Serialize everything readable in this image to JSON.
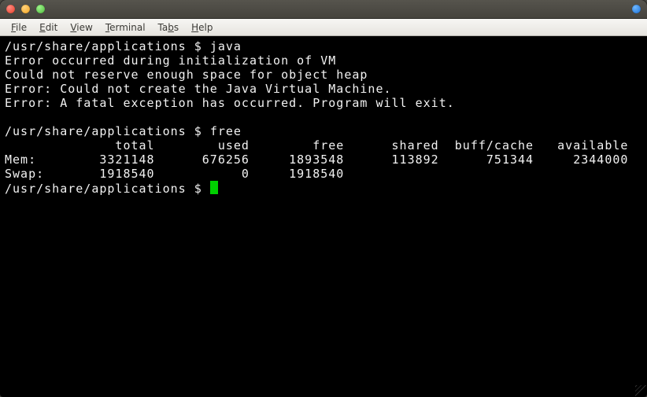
{
  "menubar": {
    "file": "File",
    "edit": "Edit",
    "view": "View",
    "terminal": "Terminal",
    "tabs": "Tabs",
    "help": "Help"
  },
  "prompt": {
    "cwd": "/usr/share/applications",
    "sep": " $ "
  },
  "commands": {
    "java": "java",
    "free": "free"
  },
  "java_output": {
    "l1": "Error occurred during initialization of VM",
    "l2": "Could not reserve enough space for object heap",
    "l3": "Error: Could not create the Java Virtual Machine.",
    "l4": "Error: A fatal exception has occurred. Program will exit."
  },
  "free_output": {
    "header": "              total        used        free      shared  buff/cache   available",
    "mem": "Mem:        3321148      676256     1893548      113892      751344     2344000",
    "swap": "Swap:       1918540           0     1918540"
  }
}
